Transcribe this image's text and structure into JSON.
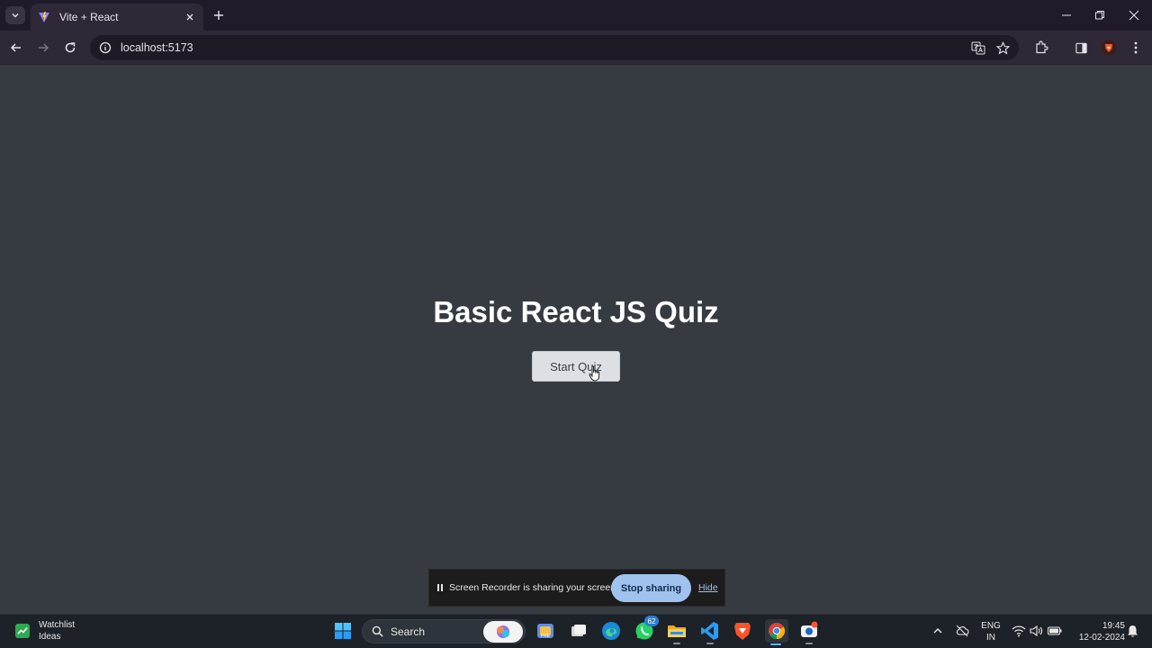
{
  "browser": {
    "tab_title": "Vite + React",
    "url": "localhost:5173"
  },
  "page": {
    "heading": "Basic React JS Quiz",
    "start_button": "Start Quiz"
  },
  "share_bar": {
    "message": "Screen Recorder is sharing your screen.",
    "stop_label": "Stop sharing",
    "hide_label": "Hide"
  },
  "taskbar": {
    "widget_title": "Watchlist",
    "widget_subtitle": "Ideas",
    "search_label": "Search",
    "whatsapp_badge": "62",
    "lang_line1": "ENG",
    "lang_line2": "IN",
    "time": "19:45",
    "date": "12-02-2024"
  },
  "colors": {
    "page_bg": "#353b40",
    "heading": "#ffffff",
    "button_bg": "#dcdfe3",
    "stop_button": "#9fc2ee",
    "browser_frame": "#201a2a"
  },
  "icons": [
    "tab-search-icon",
    "vite-favicon-icon",
    "close-icon",
    "plus-icon",
    "minimize-icon",
    "restore-icon",
    "back-icon",
    "forward-icon",
    "reload-icon",
    "info-icon",
    "translate-icon",
    "star-icon",
    "extensions-icon",
    "sidepanel-icon",
    "brave-lion-icon",
    "kebab-menu-icon",
    "pause-icon",
    "windows-start-icon",
    "search-icon",
    "copilot-icon",
    "phone-link-icon",
    "task-view-icon",
    "edge-icon",
    "whatsapp-icon",
    "file-explorer-icon",
    "vscode-icon",
    "brave-icon",
    "chrome-icon",
    "screen-recorder-icon",
    "chevron-up-icon",
    "cloud-off-icon",
    "wifi-icon",
    "volume-icon",
    "battery-icon",
    "notification-bell-icon"
  ]
}
